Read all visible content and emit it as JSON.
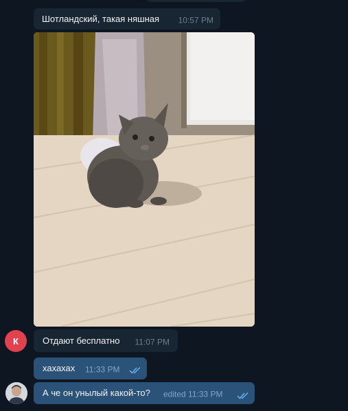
{
  "messages": [
    {
      "text": "Шотландский, такая няшная",
      "time": "10:57 PM"
    },
    {
      "text": "Отдают бесплатно",
      "time": "11:07 PM",
      "avatar_letter": "К"
    },
    {
      "text": "хахахах",
      "time": "11:33 PM"
    },
    {
      "text": "А че он унылый какой-то?",
      "time": "edited 11:33 PM"
    }
  ],
  "colors": {
    "background": "#0e1621",
    "incoming_bubble": "#182533",
    "outgoing_bubble": "#2b5278",
    "read_ticks": "#64b3f4",
    "avatar_k": "#e0424f"
  }
}
